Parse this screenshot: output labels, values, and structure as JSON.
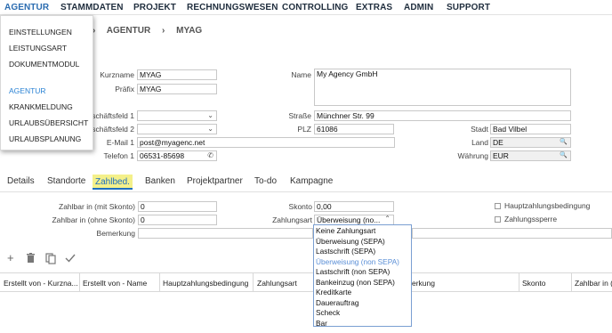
{
  "nav": {
    "items": [
      "AGENTUR",
      "STAMMDATEN",
      "PROJEKT",
      "RECHNUNGSWESEN",
      "CONTROLLING",
      "EXTRAS",
      "ADMIN",
      "SUPPORT"
    ]
  },
  "breadcrumb": {
    "item1": "AGENTUR",
    "item2": "MYAG"
  },
  "menu": {
    "items": [
      "EINSTELLUNGEN",
      "LEISTUNGSART",
      "DOKUMENTMODUL",
      "AGENTUR",
      "KRANKMELDUNG",
      "URLAUBSÜBERSICHT",
      "URLAUBSPLANUNG"
    ]
  },
  "form": {
    "kurzname_label": "Kurzname",
    "kurzname": "MYAG",
    "praefix_label": "Präfix",
    "praefix": "MYAG",
    "name_label": "Name",
    "name": "My Agency GmbH",
    "gf1_label": "schäftsfeld 1",
    "gf2_label": "schäftsfeld 2",
    "strasse_label": "Straße",
    "strasse": "Münchner Str. 99",
    "plz_label": "PLZ",
    "plz": "61086",
    "stadt_label": "Stadt",
    "stadt": "Bad Vilbel",
    "email_label": "E-Mail 1",
    "email": "post@myagenc.net",
    "land_label": "Land",
    "land": "DE",
    "telefon_label": "Telefon 1",
    "telefon": "06531-85698",
    "waehrung_label": "Währung",
    "waehrung": "EUR"
  },
  "tabs": [
    "Details",
    "Standorte",
    "Zahlbed.",
    "Banken",
    "Projektpartner",
    "To-do",
    "Kampagne"
  ],
  "zahl": {
    "skonto_mit_label": "Zahlbar in (mit Skonto)",
    "skonto_mit": "0",
    "ohne_label": "Zahlbar in (ohne Skonto)",
    "ohne": "0",
    "bemerkung_label": "Bemerkung",
    "skonto_label": "Skonto",
    "skonto": "0,00",
    "zahlungsart_label": "Zahlungsart",
    "zahlungsart": "Überweisung (no...",
    "hauptbed_label": "Hauptzahlungsbedingung",
    "sperre_label": "Zahlungssperre"
  },
  "icons": [
    "plus-icon",
    "trash-icon",
    "copy-icon",
    "check-icon"
  ],
  "table": {
    "headers": [
      "Erstellt von - Kurzna...",
      "Erstellt von - Name",
      "Hauptzahlungsbedingung",
      "Zahlungsart",
      "erkung",
      "Skonto",
      "Zahlbar in ("
    ]
  },
  "options": [
    "Keine Zahlungsart",
    "Überweisung (SEPA)",
    "Lastschrift (SEPA)",
    "Überweisung (non SEPA)",
    "Lastschrift (non SEPA)",
    "Bankeinzug (non SEPA)",
    "Kreditkarte",
    "Dauerauftrag",
    "Scheck",
    "Bar"
  ],
  "colors": {
    "accent": "#2b83d4",
    "highlight": "#f4f08a",
    "tab_active": "#1f6fbf"
  }
}
